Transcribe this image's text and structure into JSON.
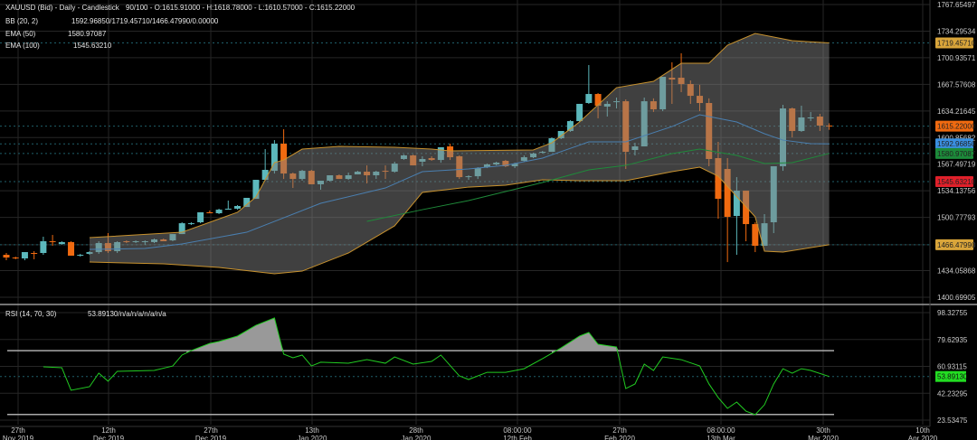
{
  "header": {
    "symbol": "XAUUSD (Bid) - Daily - Candlestick",
    "ohlc_text": "90/100 - O:1615.91000 - H:1618.78000 - L:1610.57000 - C:1615.22000",
    "bb_label": "BB (20, 2)",
    "bb_value": "1592.96850/1719.45710/1466.47990/0.00000",
    "ema50_label": "EMA (50)",
    "ema50_value": "1580.97087",
    "ema100_label": "EMA (100)",
    "ema100_value": "1545.63210",
    "rsi_label": "RSI (14, 70, 30)",
    "rsi_value": "53.89130/n/a/n/a/n/a/n/a"
  },
  "colors": {
    "up": "#5cb8bc",
    "down": "#f06a10",
    "band_fill": "#808080",
    "band_edge": "#c8922e",
    "bb_middle": "#4a7fb0",
    "ema50": "#1f8a3a",
    "rsi_line": "#22cc22",
    "bb_upper_badge": "#d9a53a",
    "close_badge": "#f06a10",
    "bb_middle_badge": "#3a8fe0",
    "ema50_badge": "#1c8a3a",
    "ema100_badge": "#e0202a",
    "bb_lower_badge": "#d9a53a",
    "rsi_badge": "#22dd22"
  },
  "chart_data": [
    {
      "type": "candlestick",
      "price_axis": {
        "ylim": [
          1400.69905,
          1767.65497
        ],
        "ticks": [
          "1767.65497",
          "1734.29534",
          "1700.93571",
          "1667.57608",
          "1634.21645",
          "1600.85682",
          "1567.49719",
          "1534.13756",
          "1500.77793",
          "1466.47990",
          "1434.05868",
          "1400.69905"
        ]
      },
      "x_ticks": [
        {
          "line1": "27th",
          "line2": "Nov 2019"
        },
        {
          "line1": "12th",
          "line2": "Dec 2019"
        },
        {
          "line1": "27th",
          "line2": "Dec 2019"
        },
        {
          "line1": "13th",
          "line2": "Jan 2020"
        },
        {
          "line1": "28th",
          "line2": "Jan 2020"
        },
        {
          "line1": "08:00:00",
          "line2": "12th Feb"
        },
        {
          "line1": "27th",
          "line2": "Feb 2020"
        },
        {
          "line1": "08:00:00",
          "line2": "13th Mar"
        },
        {
          "line1": "30th",
          "line2": "Mar 2020"
        },
        {
          "line1": "10th",
          "line2": "Apr 2020"
        }
      ],
      "ohlc": [
        [
          1453.9,
          1456.2,
          1447.1,
          1450.5
        ],
        [
          1450.5,
          1451.6,
          1448.3,
          1449.4
        ],
        [
          1449.4,
          1450.5,
          1447.1,
          1457.3
        ],
        [
          1456.2,
          1458.5,
          1448.3,
          1455.1
        ],
        [
          1456.2,
          1476.6,
          1453.9,
          1470.9
        ],
        [
          1470.9,
          1478.8,
          1465.2,
          1469.8
        ],
        [
          1467.5,
          1470.9,
          1466.4,
          1469.8
        ],
        [
          1469.8,
          1470.9,
          1452.8,
          1452.8
        ],
        [
          1452.8,
          1455.1,
          1451.6,
          1453.9
        ],
        [
          1455.1,
          1458.5,
          1453.9,
          1457.3
        ],
        [
          1457.3,
          1470.9,
          1455.1,
          1468.6
        ],
        [
          1468.6,
          1481.1,
          1456.2,
          1458.5
        ],
        [
          1458.5,
          1470.9,
          1456.2,
          1469.8
        ],
        [
          1470.9,
          1472.0,
          1468.6,
          1469.8
        ],
        [
          1469.8,
          1472.0,
          1468.6,
          1470.9
        ],
        [
          1469.8,
          1472.0,
          1466.4,
          1470.9
        ],
        [
          1469.8,
          1474.3,
          1468.6,
          1473.2
        ],
        [
          1473.2,
          1474.3,
          1470.9,
          1470.9
        ],
        [
          1472.0,
          1479.9,
          1470.9,
          1479.9
        ],
        [
          1479.9,
          1494.7,
          1479.9,
          1493.5
        ],
        [
          1492.4,
          1494.7,
          1491.3,
          1493.5
        ],
        [
          1494.7,
          1507.2,
          1493.5,
          1507.2
        ],
        [
          1507.2,
          1509.4,
          1506.0,
          1506.0
        ],
        [
          1506.0,
          1511.7,
          1504.9,
          1510.5
        ],
        [
          1510.5,
          1521.9,
          1510.5,
          1511.7
        ],
        [
          1511.7,
          1516.2,
          1510.5,
          1515.1
        ],
        [
          1513.9,
          1525.3,
          1513.9,
          1525.3
        ],
        [
          1524.1,
          1547.9,
          1524.1,
          1547.9
        ],
        [
          1547.9,
          1586.4,
          1546.8,
          1560.4
        ],
        [
          1559.2,
          1597.7,
          1555.8,
          1593.2
        ],
        [
          1593.2,
          1611.3,
          1549.0,
          1555.8
        ],
        [
          1555.8,
          1557.0,
          1537.7,
          1549.0
        ],
        [
          1549.0,
          1560.4,
          1546.8,
          1559.2
        ],
        [
          1559.2,
          1560.4,
          1542.3,
          1542.3
        ],
        [
          1542.3,
          1546.8,
          1535.5,
          1546.8
        ],
        [
          1546.8,
          1553.6,
          1545.7,
          1553.6
        ],
        [
          1553.6,
          1554.7,
          1549.0,
          1549.0
        ],
        [
          1549.0,
          1557.0,
          1547.9,
          1553.6
        ],
        [
          1554.7,
          1559.2,
          1554.7,
          1558.1
        ],
        [
          1558.1,
          1566.0,
          1543.4,
          1553.6
        ],
        [
          1553.6,
          1559.2,
          1549.0,
          1558.1
        ],
        [
          1559.2,
          1566.0,
          1549.0,
          1558.1
        ],
        [
          1558.1,
          1570.6,
          1556.9,
          1568.3
        ],
        [
          1574.0,
          1579.6,
          1573.0,
          1578.5
        ],
        [
          1578.5,
          1579.6,
          1566.0,
          1566.0
        ],
        [
          1570.6,
          1577.4,
          1564.9,
          1574.0
        ],
        [
          1575.1,
          1577.4,
          1571.7,
          1572.8
        ],
        [
          1572.8,
          1588.7,
          1569.4,
          1588.7
        ],
        [
          1589.8,
          1593.2,
          1572.8,
          1576.2
        ],
        [
          1577.4,
          1578.5,
          1549.0,
          1551.3
        ],
        [
          1551.3,
          1553.6,
          1547.9,
          1552.4
        ],
        [
          1552.4,
          1563.8,
          1549.0,
          1562.6
        ],
        [
          1563.8,
          1568.3,
          1562.6,
          1567.2
        ],
        [
          1567.2,
          1570.6,
          1566.0,
          1569.4
        ],
        [
          1571.7,
          1572.8,
          1563.8,
          1564.9
        ],
        [
          1564.9,
          1569.4,
          1562.6,
          1568.3
        ],
        [
          1571.7,
          1578.5,
          1570.6,
          1576.2
        ],
        [
          1576.2,
          1581.9,
          1575.1,
          1580.8
        ],
        [
          1581.9,
          1584.2,
          1580.8,
          1583.0
        ],
        [
          1583.0,
          1601.1,
          1583.0,
          1600.0
        ],
        [
          1600.0,
          1609.1,
          1598.9,
          1609.1
        ],
        [
          1609.1,
          1622.7,
          1608.0,
          1621.5
        ],
        [
          1621.5,
          1643.1,
          1620.4,
          1643.1
        ],
        [
          1644.2,
          1691.8,
          1643.1,
          1655.5
        ],
        [
          1655.5,
          1656.6,
          1625.0,
          1640.8
        ],
        [
          1639.7,
          1646.4,
          1627.2,
          1643.1
        ],
        [
          1645.3,
          1651.0,
          1637.4,
          1646.4
        ],
        [
          1646.4,
          1648.7,
          1561.5,
          1583.0
        ],
        [
          1585.3,
          1594.3,
          1578.5,
          1589.8
        ],
        [
          1589.8,
          1651.0,
          1589.8,
          1646.4
        ],
        [
          1646.4,
          1650.0,
          1633.0,
          1636.3
        ],
        [
          1636.3,
          1677.0,
          1634.0,
          1677.0
        ],
        [
          1675.9,
          1695.2,
          1643.1,
          1673.6
        ],
        [
          1675.9,
          1706.5,
          1657.8,
          1668.0
        ],
        [
          1668.0,
          1672.5,
          1643.1,
          1653.2
        ],
        [
          1653.2,
          1667.0,
          1634.0,
          1644.2
        ],
        [
          1644.2,
          1650.0,
          1564.9,
          1574.0
        ],
        [
          1575.1,
          1595.5,
          1499.2,
          1524.1
        ],
        [
          1561.5,
          1575.1,
          1444.8,
          1501.5
        ],
        [
          1502.6,
          1551.3,
          1453.9,
          1534.3
        ],
        [
          1534.3,
          1534.3,
          1470.9,
          1492.4
        ],
        [
          1492.4,
          1494.7,
          1457.3,
          1465.2
        ],
        [
          1465.2,
          1504.9,
          1465.2,
          1493.5
        ],
        [
          1494.7,
          1564.9,
          1481.1,
          1564.9
        ],
        [
          1564.9,
          1641.9,
          1559.2,
          1637.4
        ],
        [
          1637.4,
          1638.5,
          1601.1,
          1609.1
        ],
        [
          1609.1,
          1640.8,
          1608.0,
          1626.1
        ],
        [
          1625.0,
          1632.9,
          1621.5,
          1626.1
        ],
        [
          1627.2,
          1630.6,
          1609.1,
          1615.9
        ],
        [
          1615.91,
          1618.78,
          1610.57,
          1615.22
        ]
      ],
      "bb_upper": [
        [
          10,
          1475.4
        ],
        [
          20,
          1482.2
        ],
        [
          26,
          1507.2
        ],
        [
          28,
          1526.4
        ],
        [
          30,
          1569.4
        ],
        [
          31,
          1572.8
        ],
        [
          33,
          1586.4
        ],
        [
          37,
          1589.8
        ],
        [
          43,
          1588.7
        ],
        [
          47,
          1586.4
        ],
        [
          49,
          1584.2
        ],
        [
          58,
          1585.3
        ],
        [
          60,
          1594.3
        ],
        [
          63,
          1620.4
        ],
        [
          67,
          1663.4
        ],
        [
          71,
          1671.4
        ],
        [
          74,
          1694.0
        ],
        [
          77,
          1694.0
        ],
        [
          79,
          1716.7
        ],
        [
          82,
          1731.4
        ],
        [
          86,
          1722.3
        ],
        [
          90,
          1719.5
        ]
      ],
      "bb_middle": [
        [
          10,
          1460.7
        ],
        [
          16,
          1461.8
        ],
        [
          20,
          1467.5
        ],
        [
          27,
          1482.2
        ],
        [
          30,
          1495.8
        ],
        [
          35,
          1518.5
        ],
        [
          42,
          1537.7
        ],
        [
          46,
          1558.1
        ],
        [
          51,
          1561.5
        ],
        [
          55,
          1566.0
        ],
        [
          59,
          1575.1
        ],
        [
          64,
          1595.5
        ],
        [
          68,
          1595.5
        ],
        [
          73,
          1614.7
        ],
        [
          76,
          1629.5
        ],
        [
          80,
          1620.4
        ],
        [
          83,
          1605.7
        ],
        [
          85,
          1597.7
        ],
        [
          88,
          1593.2
        ],
        [
          90,
          1593.0
        ]
      ],
      "bb_lower": [
        [
          10,
          1444.8
        ],
        [
          18,
          1442.6
        ],
        [
          24,
          1438.1
        ],
        [
          30,
          1430.1
        ],
        [
          33,
          1433.5
        ],
        [
          38,
          1456.2
        ],
        [
          43,
          1490.2
        ],
        [
          46,
          1532.1
        ],
        [
          51,
          1538.8
        ],
        [
          55,
          1541.1
        ],
        [
          59,
          1547.9
        ],
        [
          63,
          1546.8
        ],
        [
          68,
          1546.8
        ],
        [
          73,
          1558.1
        ],
        [
          76,
          1563.8
        ],
        [
          78,
          1552.4
        ],
        [
          82,
          1501.5
        ],
        [
          83,
          1458.5
        ],
        [
          85,
          1457.3
        ],
        [
          90,
          1466.5
        ]
      ],
      "ema50": [
        [
          40,
          1495.8
        ],
        [
          46,
          1510.5
        ],
        [
          51,
          1521.9
        ],
        [
          59,
          1544.5
        ],
        [
          64,
          1560.4
        ],
        [
          68,
          1566.0
        ],
        [
          73,
          1580.8
        ],
        [
          76,
          1586.4
        ],
        [
          80,
          1578.5
        ],
        [
          83,
          1568.3
        ],
        [
          86,
          1569.4
        ],
        [
          90,
          1581.0
        ]
      ],
      "badges": [
        {
          "value": "1719.45710",
          "price": 1719.4571,
          "color_key": "bb_upper_badge"
        },
        {
          "value": "1615.22000",
          "price": 1615.22,
          "color_key": "close_badge"
        },
        {
          "value": "1592.96850",
          "price": 1592.9685,
          "color_key": "bb_middle_badge"
        },
        {
          "value": "1580.97087",
          "price": 1580.97087,
          "color_key": "ema50_badge"
        },
        {
          "value": "1545.63210",
          "price": 1545.6321,
          "color_key": "ema100_badge"
        },
        {
          "value": "1466.47990",
          "price": 1466.4799,
          "color_key": "bb_lower_badge"
        }
      ]
    },
    {
      "type": "line",
      "name": "RSI (14, 70, 30)",
      "ylim": [
        23.53475,
        98.32755
      ],
      "ticks": [
        "98.32755",
        "79.62935",
        "60.93115",
        "42.23295",
        "23.53475"
      ],
      "levels": [
        70,
        30
      ],
      "values": [
        [
          5,
          60.6
        ],
        [
          7,
          60.0
        ],
        [
          8,
          44.3
        ],
        [
          10,
          46.8
        ],
        [
          11,
          56.2
        ],
        [
          12,
          50.6
        ],
        [
          13,
          57.5
        ],
        [
          17,
          58.1
        ],
        [
          19,
          61.2
        ],
        [
          20,
          68.8
        ],
        [
          21,
          71.9
        ],
        [
          23,
          76.9
        ],
        [
          24,
          78.2
        ],
        [
          26,
          82.0
        ],
        [
          28,
          89.5
        ],
        [
          30,
          94.6
        ],
        [
          31,
          69.4
        ],
        [
          32,
          66.9
        ],
        [
          33,
          68.8
        ],
        [
          34,
          61.2
        ],
        [
          35,
          63.8
        ],
        [
          38,
          63.1
        ],
        [
          40,
          65.6
        ],
        [
          42,
          63.1
        ],
        [
          43,
          67.5
        ],
        [
          45,
          62.5
        ],
        [
          47,
          64.4
        ],
        [
          48,
          68.8
        ],
        [
          50,
          54.3
        ],
        [
          51,
          51.8
        ],
        [
          53,
          56.8
        ],
        [
          55,
          56.8
        ],
        [
          57,
          59.3
        ],
        [
          59,
          66.3
        ],
        [
          61,
          73.8
        ],
        [
          63,
          82.0
        ],
        [
          64,
          84.5
        ],
        [
          65,
          76.3
        ],
        [
          67,
          74.4
        ],
        [
          68,
          45.5
        ],
        [
          69,
          48.7
        ],
        [
          70,
          62.5
        ],
        [
          71,
          58.1
        ],
        [
          72,
          67.5
        ],
        [
          74,
          65.6
        ],
        [
          76,
          61.2
        ],
        [
          77,
          48.7
        ],
        [
          78,
          39.2
        ],
        [
          79,
          31.7
        ],
        [
          80,
          36.1
        ],
        [
          81,
          29.8
        ],
        [
          82,
          27.3
        ],
        [
          83,
          34.2
        ],
        [
          84,
          48.7
        ],
        [
          85,
          59.3
        ],
        [
          86,
          56.2
        ],
        [
          87,
          59.3
        ],
        [
          88,
          58.1
        ],
        [
          90,
          53.9
        ]
      ],
      "badge": {
        "value": "53.89130",
        "level": 53.8913,
        "color_key": "rsi_badge"
      }
    }
  ]
}
